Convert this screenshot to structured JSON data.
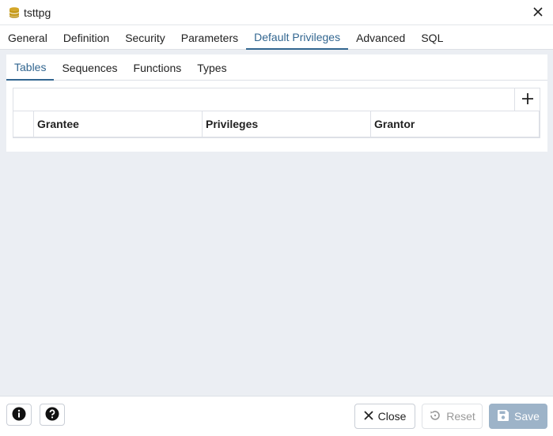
{
  "window": {
    "title": "tsttpg",
    "icons": {
      "db": "database-icon",
      "close": "close-icon"
    }
  },
  "main_tabs": [
    {
      "label": "General"
    },
    {
      "label": "Definition"
    },
    {
      "label": "Security"
    },
    {
      "label": "Parameters"
    },
    {
      "label": "Default Privileges",
      "active": true
    },
    {
      "label": "Advanced"
    },
    {
      "label": "SQL"
    }
  ],
  "sub_tabs": [
    {
      "label": "Tables",
      "active": true
    },
    {
      "label": "Sequences"
    },
    {
      "label": "Functions"
    },
    {
      "label": "Types"
    }
  ],
  "grid": {
    "columns": [
      "Grantee",
      "Privileges",
      "Grantor"
    ],
    "add_icon": "plus-icon",
    "rows": []
  },
  "footer": {
    "info_icon": "info-icon",
    "help_icon": "help-icon",
    "close_label": "Close",
    "reset_label": "Reset",
    "save_label": "Save"
  },
  "colors": {
    "accent": "#326690",
    "save_disabled": "#9db3c8",
    "db_icon": "#c59a1a"
  }
}
